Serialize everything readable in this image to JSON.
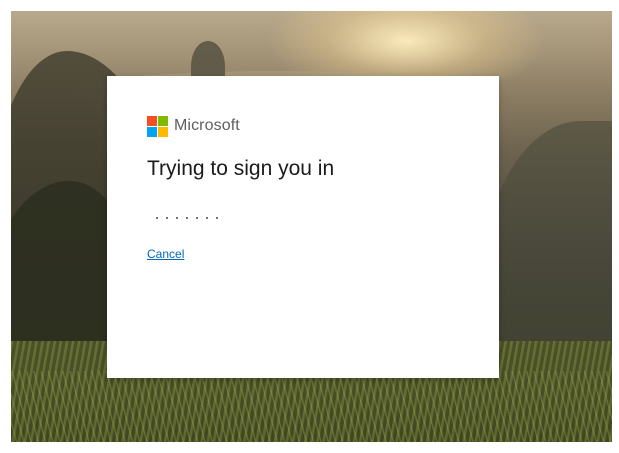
{
  "background": {
    "description_icon": "landscape-background"
  },
  "dialog": {
    "brand": {
      "name": "Microsoft",
      "logo_icon": "microsoft-logo-icon",
      "logo_colors": [
        "#f25022",
        "#7fba00",
        "#00a4ef",
        "#ffb900"
      ]
    },
    "title": "Trying to sign you in",
    "progress_icon": "progress-dots-icon",
    "cancel_label": "Cancel"
  },
  "colors": {
    "link": "#0067b8",
    "title_text": "#1b1b1b",
    "brand_text": "#5e5e5e",
    "dialog_bg": "#ffffff"
  }
}
